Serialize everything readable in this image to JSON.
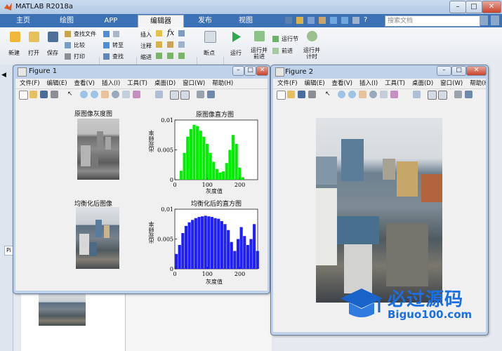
{
  "matlab": {
    "title": "MATLAB R2018a",
    "tabs": [
      "主页",
      "绘图",
      "APP",
      "编辑器",
      "发布",
      "视图"
    ],
    "active_tab": "编辑器",
    "search_placeholder": "搜索文档",
    "ribbon": {
      "new": "新建",
      "open": "打开",
      "save": "保存",
      "find_files": "查找文件",
      "compare": "比较",
      "print": "打印",
      "goto": "转至",
      "find": "查找",
      "insert": "插入",
      "comment": "注释",
      "indent": "缩进",
      "breakpoints": "断点",
      "run": "运行",
      "run_advance": "运行并\n前进",
      "run_section": "运行节",
      "advance": "前进",
      "run_time": "运行并\n计时"
    },
    "sidebar_fragment": "Pi"
  },
  "figure1": {
    "title": "Figure 1",
    "menu": [
      "文件(F)",
      "编辑(E)",
      "查看(V)",
      "插入(I)",
      "工具(T)",
      "桌面(D)",
      "窗口(W)",
      "帮助(H)"
    ],
    "img1_title": "原图像灰度图",
    "img2_title": "均衡化后图像",
    "chart1_title": "原图像直方图",
    "chart2_title": "均衡化后的直方图",
    "xlabel": "灰度值",
    "ylabel": "出现频率"
  },
  "figure2": {
    "title": "Figure 2",
    "menu": [
      "文件(F)",
      "编辑(E)",
      "查看(V)",
      "插入(I)",
      "工具(T)",
      "桌面(D)",
      "窗口(W)",
      "帮助(H)"
    ]
  },
  "watermark": {
    "main": "必过源码",
    "url": "Biguo100.com"
  },
  "chart_data": [
    {
      "type": "bar",
      "title": "原图像直方图",
      "xlabel": "灰度值",
      "ylabel": "出现频率",
      "xlim": [
        0,
        255
      ],
      "ylim": [
        0,
        0.01
      ],
      "xticks": [
        0,
        100,
        200
      ],
      "yticks": [
        "0",
        "0.005",
        "0.01"
      ],
      "color": "#00ee00",
      "x": [
        10,
        20,
        30,
        40,
        50,
        60,
        70,
        80,
        90,
        100,
        110,
        120,
        130,
        140,
        150,
        160,
        170,
        180,
        190,
        200,
        210,
        220,
        230,
        240,
        250
      ],
      "values": [
        0.0,
        0.0015,
        0.0045,
        0.0072,
        0.0085,
        0.0092,
        0.009,
        0.0082,
        0.0072,
        0.006,
        0.0045,
        0.003,
        0.0018,
        0.0012,
        0.0014,
        0.0028,
        0.005,
        0.0075,
        0.006,
        0.002,
        0.0004,
        0.0,
        0.0,
        0.0,
        0.0
      ]
    },
    {
      "type": "bar",
      "title": "均衡化后的直方图",
      "xlabel": "灰度值",
      "ylabel": "出现频率",
      "xlim": [
        0,
        255
      ],
      "ylim": [
        0,
        0.01
      ],
      "xticks": [
        0,
        100,
        200
      ],
      "yticks": [
        "0",
        "0.005",
        "0.01"
      ],
      "color": "#1e1eff",
      "x": [
        5,
        15,
        25,
        35,
        45,
        55,
        65,
        75,
        85,
        95,
        105,
        115,
        125,
        135,
        145,
        155,
        165,
        175,
        185,
        195,
        205,
        215,
        225,
        235,
        245,
        255
      ],
      "values": [
        0.0025,
        0.004,
        0.006,
        0.0072,
        0.0078,
        0.0082,
        0.0085,
        0.0087,
        0.0088,
        0.0089,
        0.0088,
        0.0087,
        0.0085,
        0.0084,
        0.008,
        0.0075,
        0.0065,
        0.0045,
        0.003,
        0.005,
        0.007,
        0.0055,
        0.004,
        0.005,
        0.0075,
        0.003
      ]
    }
  ]
}
